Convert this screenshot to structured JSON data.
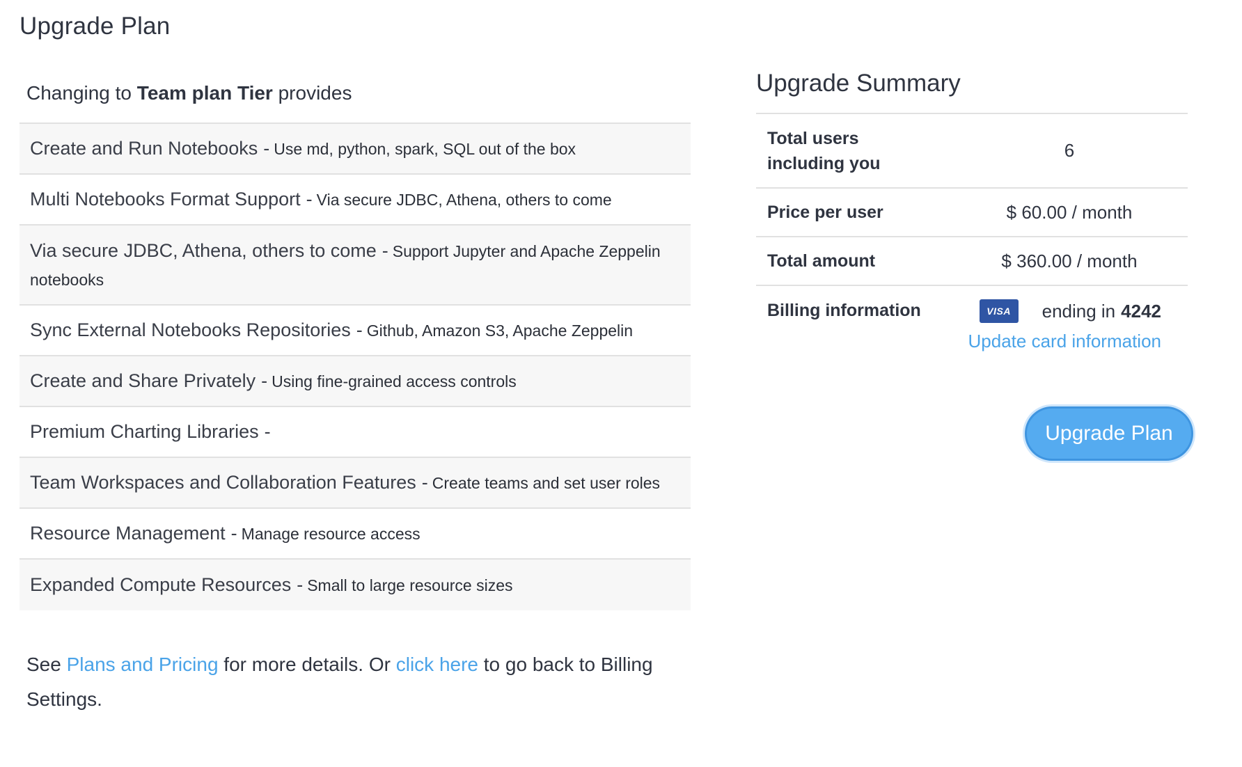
{
  "page": {
    "title": "Upgrade Plan"
  },
  "intro": {
    "prefix": "Changing to ",
    "plan": "Team plan Tier",
    "suffix": " provides"
  },
  "features": [
    {
      "name": "Create and Run Notebooks",
      "desc": "Use md, python, spark, SQL out of the box"
    },
    {
      "name": "Multi Notebooks Format Support",
      "desc": "Via secure JDBC, Athena, others to come"
    },
    {
      "name": "Via secure JDBC, Athena, others to come",
      "desc": "Support Jupyter and Apache Zeppelin notebooks"
    },
    {
      "name": "Sync External Notebooks Repositories",
      "desc": "Github, Amazon S3, Apache Zeppelin"
    },
    {
      "name": "Create and Share Privately",
      "desc": "Using fine-grained access controls"
    },
    {
      "name": "Premium Charting Libraries",
      "desc": ""
    },
    {
      "name": "Team Workspaces and Collaboration Features",
      "desc": "Create teams and set user roles"
    },
    {
      "name": "Resource Management",
      "desc": "Manage resource access"
    },
    {
      "name": "Expanded Compute Resources",
      "desc": "Small to large resource sizes"
    }
  ],
  "separator": "-",
  "footer": {
    "see": "See",
    "plans_link": "Plans and Pricing",
    "middle": "for more details. Or",
    "click_link": "click here",
    "end": "to go back to Billing Settings."
  },
  "summary": {
    "title": "Upgrade Summary",
    "total_users_label": "Total users including you",
    "total_users_value": "6",
    "price_label": "Price per user",
    "price_value": "$ 60.00 / month",
    "total_label": "Total amount",
    "total_value": "$ 360.00 / month",
    "billing_label": "Billing information",
    "card_brand": "VISA",
    "card_ending_text": "ending in",
    "card_last4": "4242",
    "update_link": "Update card information"
  },
  "actions": {
    "upgrade_button": "Upgrade Plan"
  },
  "colors": {
    "link": "#4aa3e8",
    "button": "#55abf0",
    "visa": "#2f55a4"
  }
}
